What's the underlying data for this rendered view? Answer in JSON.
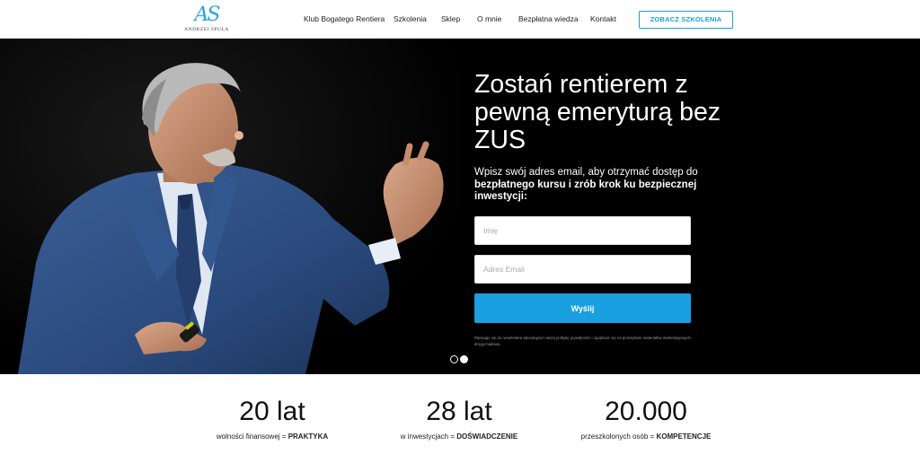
{
  "header": {
    "logo_mark": "AS",
    "logo_name": "ANDRZEJ SPUŁA",
    "nav": [
      {
        "label": "Klub Bogatego Rentiera"
      },
      {
        "label": "Szkolenia"
      },
      {
        "label": "Sklep"
      },
      {
        "label": "O mnie"
      },
      {
        "label": "Bezpłatna wiedza"
      },
      {
        "label": "Kontakt"
      }
    ],
    "cta_label": "ZOBACZ SZKOLENIA"
  },
  "hero": {
    "title": "Zostań rentierem z pewną emeryturą bez ZUS",
    "text_prefix": "Wpisz swój adres email, aby otrzymać dostęp do ",
    "text_bold": "bezpłatnego kursu i zrób krok ku bezpiecznej inwestycji:",
    "name_placeholder": "Imię",
    "email_placeholder": "Adres Email",
    "submit_label": "Wyślij",
    "disclaimer": "Wpisując się do newslettera akceptujesz naszą politykę prywatności i zgadzasz się na przesyłanie materiałów marketingowych drogą mailową.",
    "carousel": {
      "slides": 2,
      "active": 2
    }
  },
  "stats": [
    {
      "value": "20 lat",
      "label_plain": "wolności finansowej = ",
      "label_bold": "PRAKTYKA"
    },
    {
      "value": "28 lat",
      "label_plain": "w inwestycjach = ",
      "label_bold": "DOŚWIADCZENIE"
    },
    {
      "value": "20.000",
      "label_plain": "przeszkolonych osób = ",
      "label_bold": "KOMPETENCJE"
    }
  ],
  "colors": {
    "accent": "#18a0e0",
    "logo": "#2aa8d8",
    "hero_bg": "#000000"
  }
}
